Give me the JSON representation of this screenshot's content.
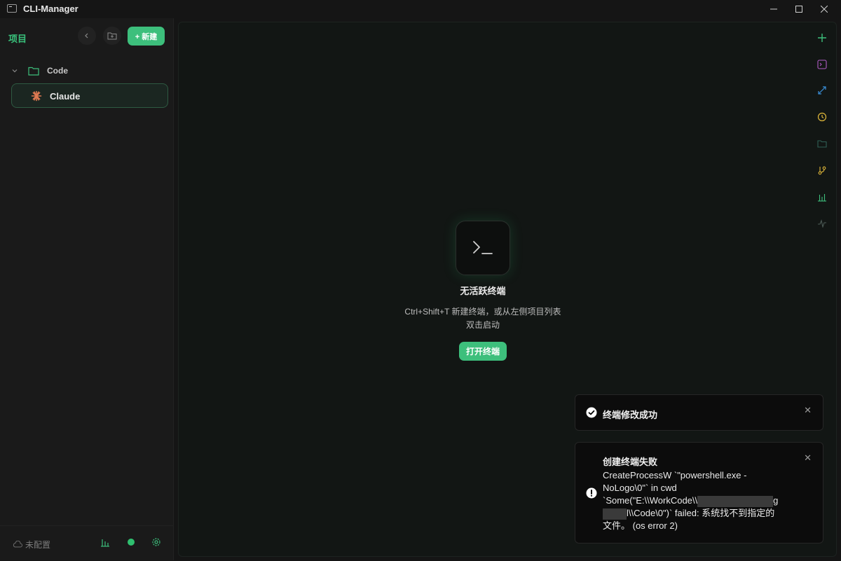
{
  "window": {
    "title": "CLI-Manager"
  },
  "sidebar": {
    "title": "项目",
    "new_label": "+ 新建",
    "folder": {
      "label": "Code"
    },
    "items": [
      {
        "label": "Claude"
      }
    ],
    "footer": {
      "status": "未配置"
    }
  },
  "main": {
    "empty_title": "无活跃终端",
    "empty_desc_line1": "Ctrl+Shift+T 新建终端，或从左侧项目列表",
    "empty_desc_line2": "双击启动",
    "open_button": "打开终端"
  },
  "toasts": {
    "success_title": "终端修改成功",
    "error_title": "创建终端失败",
    "error_line1": "CreateProcessW `\"powershell.exe -",
    "error_line2": "NoLogo\\0\"` in cwd",
    "error_line3a": "`Some(\"E:\\\\WorkCode\\\\",
    "error_line3b": "g",
    "error_line4a": "l\\\\Code\\0\")` failed: 系统找不到指定的",
    "error_line5": "文件。 (os error 2)"
  },
  "colors": {
    "accent": "#3dbf7c",
    "sidebar_title": "#39c07a"
  }
}
